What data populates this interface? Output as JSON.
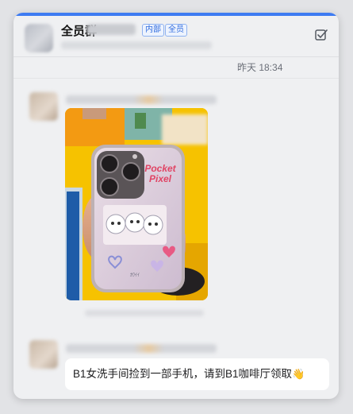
{
  "header": {
    "group_name": "全员群",
    "tags": [
      "内部",
      "全员"
    ],
    "action_icon": "checkbox-icon"
  },
  "messages": {
    "timestamp": "昨天 18:34",
    "image_message": {
      "phone_case_text": "Pocket Pixel"
    },
    "text_message": {
      "text": "B1女洗手间捡到一部手机，请到B1咖啡厅领取",
      "emoji": "👋"
    }
  },
  "colors": {
    "accent": "#3d7bf2",
    "tag_blue": "#2f6bde",
    "photo_yellow": "#f7c400",
    "shirt_orange": "#f39a12"
  }
}
